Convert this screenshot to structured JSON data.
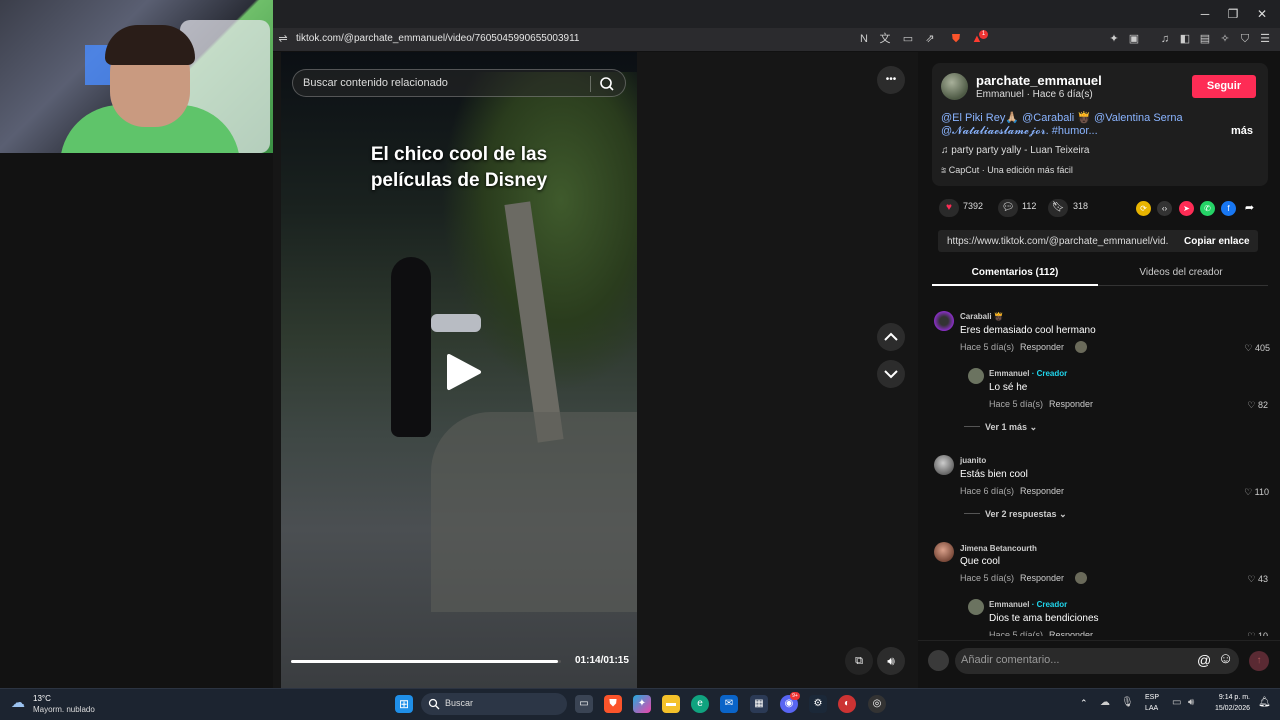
{
  "browser": {
    "url": "tiktok.com/@parchate_emmanuel/video/7605045990655003911",
    "window_controls": {
      "minimize": "─",
      "restore": "❐",
      "close": "✕"
    },
    "toolbar_icons": [
      "translate-off-icon",
      "translate-icon",
      "screencast-icon",
      "share-icon",
      "brave-shield-icon",
      "brave-rewards-icon",
      "extensions-icon",
      "tab-groups-icon",
      "media-icon",
      "sidebar-icon",
      "wallet-icon",
      "leo-ai-icon",
      "vpn-icon",
      "menu-icon"
    ],
    "notification_count": "1"
  },
  "video": {
    "search_placeholder": "Buscar contenido relacionado",
    "caption_line1": "El chico cool de las",
    "caption_line2": "películas de Disney",
    "time": "01:14/01:15",
    "progress": 0.99,
    "more_label": "•••",
    "prev_label": "⌃",
    "next_label": "⌄"
  },
  "post": {
    "author_username": "parchate_emmanuel",
    "author_sub": "Emmanuel · Hace 6 día(s)",
    "follow_label": "Seguir",
    "description_line1": "@El Piki Rey🙏🏼 @Carabali 🫅🏿 @Valentina Serna",
    "description_line2": "@𝓝𝓪𝓽𝓪𝓵𝓲𝓪𝓮𝓼𝓵𝓪𝓶𝓮𝓳𝓸𝓻. #humor...",
    "more_label": "más",
    "music": "party party yally - Luan Teixeira",
    "capcut": "CapCut · Una edición más fácil",
    "likes": "7392",
    "comments_count": "112",
    "saves": "318",
    "link": "https://www.tiktok.com/@parchate_emmanuel/vid...",
    "copy_link_label": "Copiar enlace"
  },
  "tabs": {
    "comments": "Comentarios (112)",
    "creator_videos": "Videos del creador"
  },
  "comments": [
    {
      "name": "Carabali 🫅🏿",
      "text": "Eres demasiado cool hermano",
      "time": "Hace 5 día(s)",
      "reply": "Responder",
      "likes": "405",
      "sub": {
        "name": "Emmanuel",
        "creator": "· Creador",
        "text": "Lo sé he",
        "time": "Hace 5 día(s)",
        "reply": "Responder",
        "likes": "82"
      },
      "more": "Ver 1 más"
    },
    {
      "name": "juanito",
      "text": "Estás bien cool",
      "time": "Hace 6 día(s)",
      "reply": "Responder",
      "likes": "110",
      "more": "Ver 2 respuestas"
    },
    {
      "name": "Jimena Betancourth",
      "text": "Que cool",
      "time": "Hace 5 día(s)",
      "reply": "Responder",
      "likes": "43",
      "sub": {
        "name": "Emmanuel",
        "creator": "· Creador",
        "text": "Dios te ama bendiciones",
        "time": "Hace 5 día(s)",
        "reply": "Responder",
        "likes": "10"
      }
    }
  ],
  "comment_box": {
    "placeholder": "Añadir comentario...",
    "mention": "@",
    "emoji": "☺"
  },
  "taskbar": {
    "weather_temp": "13°C",
    "weather_desc": "Mayorm. nublado",
    "search_label": "Buscar",
    "lang_line1": "ESP",
    "lang_line2": "LAA",
    "clock_time": "9:14 p. m.",
    "clock_date": "15/02/2026",
    "discord_badge": "9+"
  }
}
